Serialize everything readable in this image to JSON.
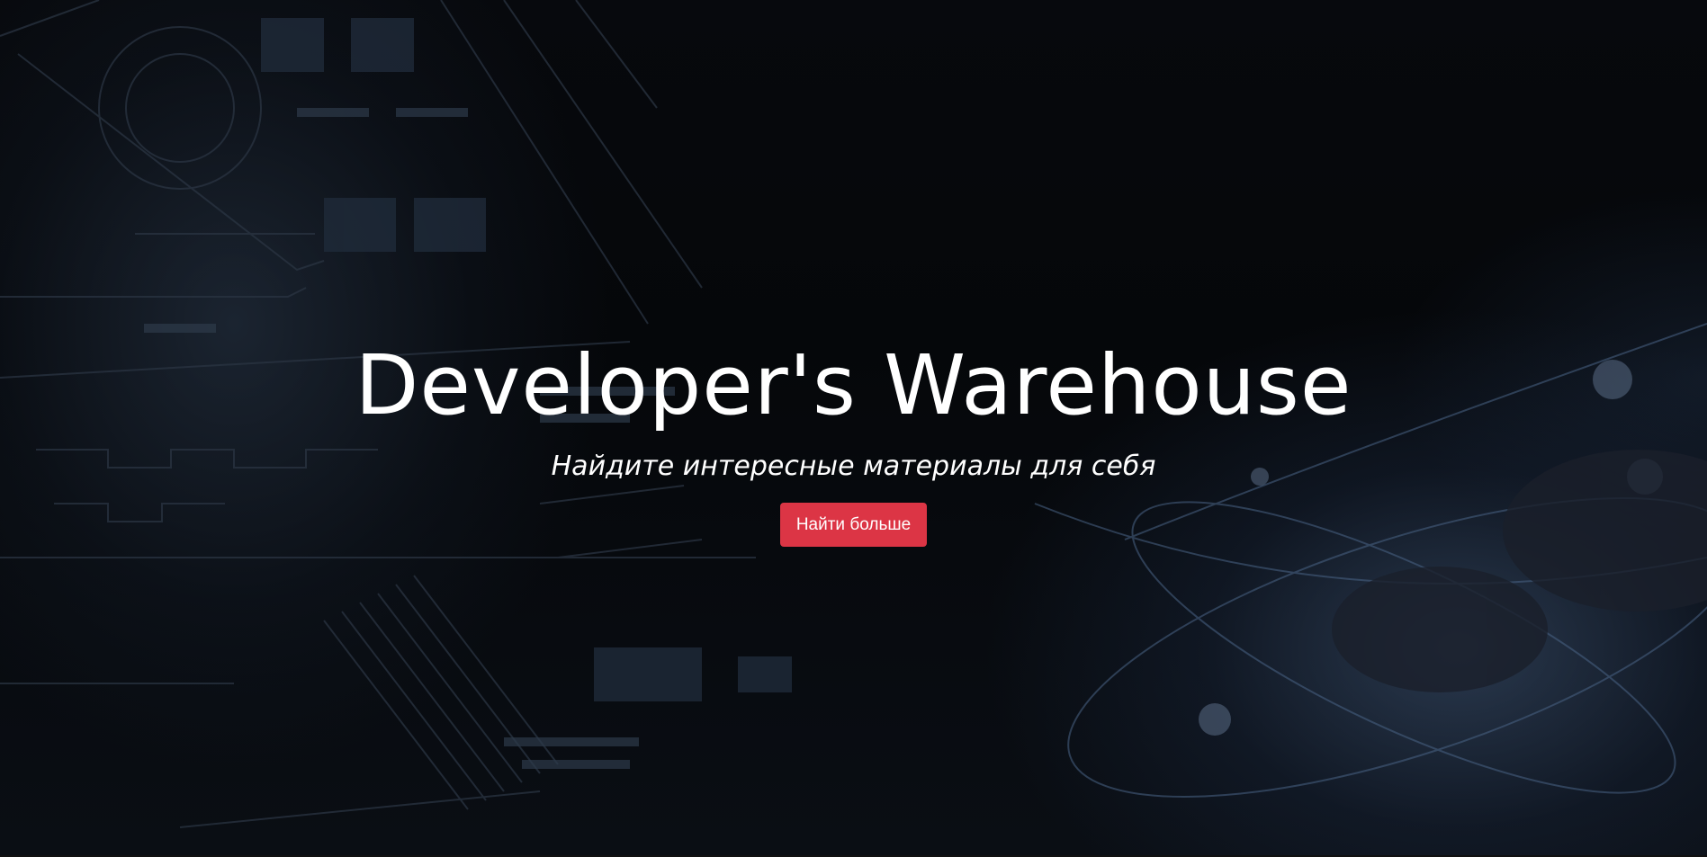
{
  "hero": {
    "title": "Developer's Warehouse",
    "subtitle": "Найдите интересные материалы для себя",
    "cta_label": "Найти больше"
  },
  "colors": {
    "cta_background": "#dc3545",
    "text": "#ffffff",
    "background": "#05070a"
  }
}
